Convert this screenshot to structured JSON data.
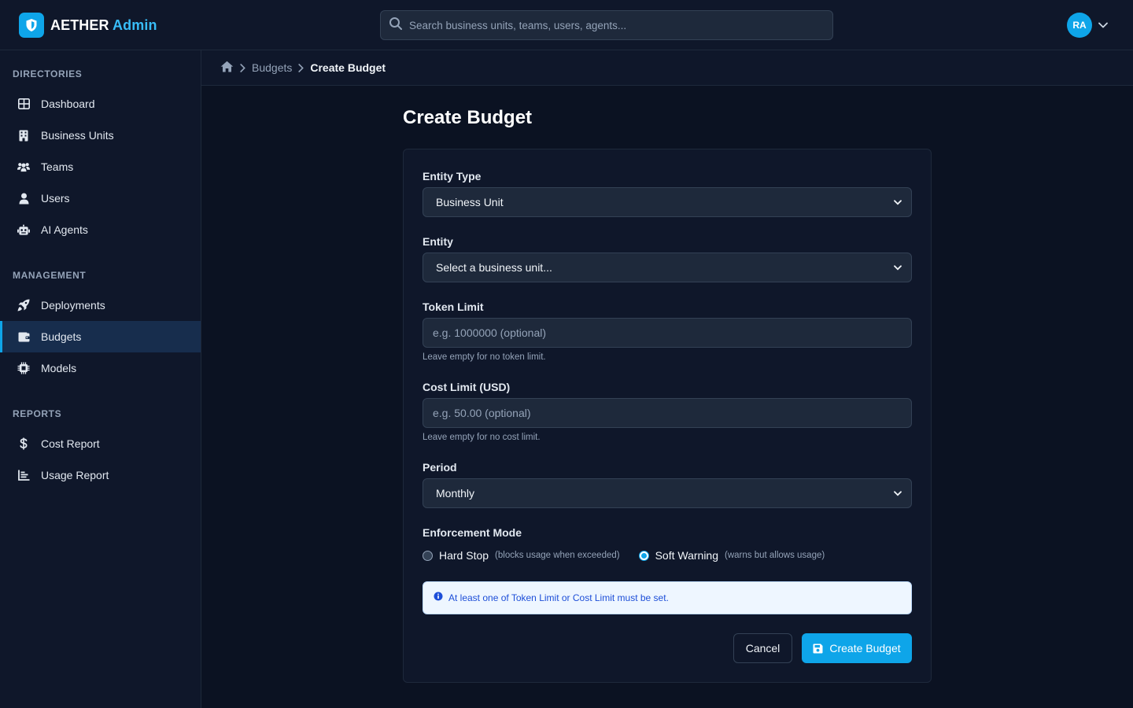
{
  "brand": {
    "name": "AETHER",
    "accent_word": "Admin",
    "accent_color": "#38bdf8",
    "icon": "shield-icon"
  },
  "search": {
    "placeholder": "Search business units, teams, users, agents...",
    "icon": "search-icon"
  },
  "user": {
    "initials": "RA",
    "icon": "chevron-down-icon"
  },
  "sidebar": {
    "sections": [
      {
        "title": "DIRECTORIES",
        "items": [
          {
            "label": "Dashboard",
            "icon": "grid-icon"
          },
          {
            "label": "Business Units",
            "icon": "building-icon"
          },
          {
            "label": "Teams",
            "icon": "users-icon"
          },
          {
            "label": "Users",
            "icon": "user-icon"
          },
          {
            "label": "AI Agents",
            "icon": "robot-icon"
          }
        ]
      },
      {
        "title": "MANAGEMENT",
        "items": [
          {
            "label": "Deployments",
            "icon": "rocket-icon"
          },
          {
            "label": "Budgets",
            "icon": "wallet-icon",
            "active": true
          },
          {
            "label": "Models",
            "icon": "chip-icon"
          }
        ]
      },
      {
        "title": "REPORTS",
        "items": [
          {
            "label": "Cost Report",
            "icon": "dollar-icon"
          },
          {
            "label": "Usage Report",
            "icon": "bar-chart-icon"
          }
        ]
      }
    ]
  },
  "breadcrumb": {
    "home_icon": "home-icon",
    "items": [
      "Budgets",
      "Create Budget"
    ]
  },
  "page": {
    "title": "Create Budget"
  },
  "form": {
    "entity_type": {
      "label": "Entity Type",
      "value": "Business Unit"
    },
    "entity": {
      "label": "Entity",
      "value": "Select a business unit..."
    },
    "token_limit": {
      "label": "Token Limit",
      "placeholder": "e.g. 1000000 (optional)",
      "help": "Leave empty for no token limit."
    },
    "cost_limit": {
      "label": "Cost Limit (USD)",
      "placeholder": "e.g. 50.00 (optional)",
      "help": "Leave empty for no cost limit."
    },
    "period": {
      "label": "Period",
      "value": "Monthly"
    },
    "enforcement": {
      "label": "Enforcement Mode",
      "options": [
        {
          "label": "Hard Stop",
          "hint": "(blocks usage when exceeded)",
          "selected": false
        },
        {
          "label": "Soft Warning",
          "hint": "(warns but allows usage)",
          "selected": true
        }
      ]
    },
    "info": {
      "text": "At least one of Token Limit or Cost Limit must be set.",
      "icon": "info-icon"
    },
    "cancel_label": "Cancel",
    "submit_label": "Create Budget",
    "submit_icon": "save-icon"
  }
}
